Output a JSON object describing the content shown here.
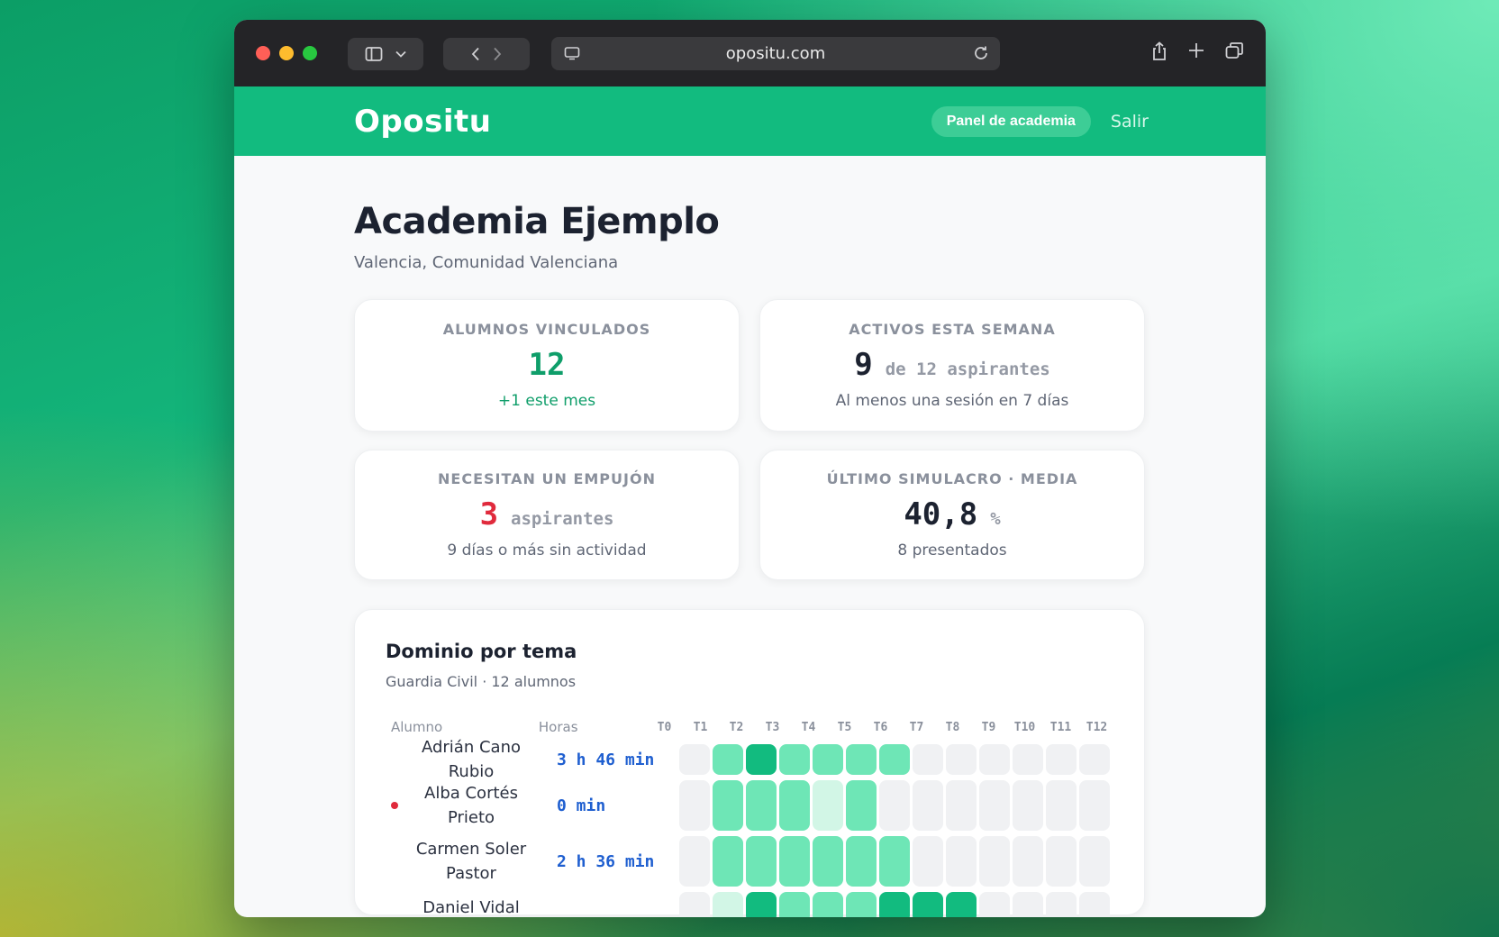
{
  "browser": {
    "url": "opositu.com"
  },
  "header": {
    "logo": "Opositu",
    "panel_button": "Panel de academia",
    "logout_link": "Salir"
  },
  "academy": {
    "name": "Academia Ejemplo",
    "location": "Valencia, Comunidad Valenciana"
  },
  "stats": {
    "linked": {
      "label": "ALUMNOS VINCULADOS",
      "value": "12",
      "note": "+1 este mes"
    },
    "active": {
      "label": "ACTIVOS ESTA SEMANA",
      "value": "9",
      "unit": "de 12 aspirantes",
      "note": "Al menos una sesión en 7 días"
    },
    "nudge": {
      "label": "NECESITAN UN EMPUJÓN",
      "value": "3",
      "unit": "aspirantes",
      "note": "9 días o más sin actividad"
    },
    "mock": {
      "label": "ÚLTIMO SIMULACRO · MEDIA",
      "value": "40,8",
      "unit": "%",
      "note": "8 presentados"
    }
  },
  "domain": {
    "title": "Dominio por tema",
    "subtitle": "Guardia Civil · 12 alumnos",
    "columns": {
      "student": "Alumno",
      "hours": "Horas"
    },
    "topics": [
      "T0",
      "T1",
      "T2",
      "T3",
      "T4",
      "T5",
      "T6",
      "T7",
      "T8",
      "T9",
      "T10",
      "T11",
      "T12"
    ],
    "rows": [
      {
        "name": "Adrián Cano Rubio",
        "hours": "3 h 46 min",
        "flag": false,
        "levels": [
          0,
          2,
          3,
          2,
          2,
          2,
          2,
          0,
          0,
          0,
          0,
          0,
          0
        ]
      },
      {
        "name": "Alba Cortés Prieto",
        "hours": "0 min",
        "flag": true,
        "levels": [
          0,
          2,
          2,
          2,
          1,
          2,
          0,
          0,
          0,
          0,
          0,
          0,
          0
        ]
      },
      {
        "name": "Carmen Soler Pastor",
        "hours": "2 h 36 min",
        "flag": false,
        "levels": [
          0,
          2,
          2,
          2,
          2,
          2,
          2,
          0,
          0,
          0,
          0,
          0,
          0
        ]
      },
      {
        "name": "Daniel Vidal",
        "hours": "",
        "flag": false,
        "levels": [
          0,
          1,
          3,
          2,
          2,
          2,
          3,
          3,
          3,
          0,
          0,
          0,
          0
        ]
      }
    ]
  }
}
